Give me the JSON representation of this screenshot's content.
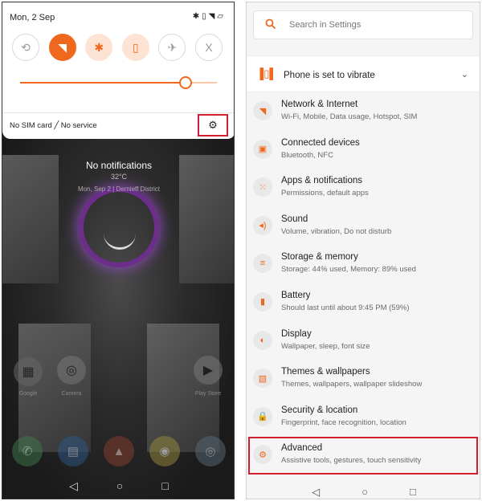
{
  "left_screen": {
    "status": {
      "date": "Mon, 2 Sep",
      "icons": [
        "bluetooth-icon",
        "vibrate-icon",
        "wifi-icon",
        "no-sim-icon"
      ]
    },
    "quick_settings": [
      {
        "icon": "auto-rotate-off-icon",
        "symbol": "⟲",
        "state": "off"
      },
      {
        "icon": "wifi-icon",
        "symbol": "◥",
        "state": "on"
      },
      {
        "icon": "bluetooth-icon",
        "symbol": "✱",
        "state": "on-light"
      },
      {
        "icon": "vibrate-icon",
        "symbol": "▯",
        "state": "on-light"
      },
      {
        "icon": "airplane-icon",
        "symbol": "✈",
        "state": "off"
      },
      {
        "icon": "x-mode-icon",
        "symbol": "X",
        "state": "off"
      }
    ],
    "brightness": 0.84,
    "sim_status": "No SIM card ╱ No service",
    "settings_gear": "⚙",
    "no_notifications": "No notifications",
    "weather": "32°C",
    "lock_date": "Mon, Sep 2  |  Dernieff District",
    "home_labels": [
      "Google",
      "Camera",
      "Play Store"
    ]
  },
  "right_screen": {
    "search_placeholder": "Search in Settings",
    "vibrate_banner": "Phone is set to vibrate",
    "items": [
      {
        "title": "Network & Internet",
        "sub": "Wi-Fi, Mobile, Data usage, Hotspot, SIM",
        "icon": "wifi-icon",
        "symbol": "◥"
      },
      {
        "title": "Connected devices",
        "sub": "Bluetooth, NFC",
        "icon": "devices-icon",
        "symbol": "▣"
      },
      {
        "title": "Apps & notifications",
        "sub": "Permissions, default apps",
        "icon": "apps-icon",
        "symbol": "⁙"
      },
      {
        "title": "Sound",
        "sub": "Volume, vibration, Do not disturb",
        "icon": "sound-icon",
        "symbol": "◂)"
      },
      {
        "title": "Storage & memory",
        "sub": "Storage: 44% used, Memory: 89% used",
        "icon": "storage-icon",
        "symbol": "≡"
      },
      {
        "title": "Battery",
        "sub": "Should last until about 9:45 PM (59%)",
        "icon": "battery-icon",
        "symbol": "▮"
      },
      {
        "title": "Display",
        "sub": "Wallpaper, sleep, font size",
        "icon": "display-icon",
        "symbol": "◐"
      },
      {
        "title": "Themes & wallpapers",
        "sub": "Themes, wallpapers, wallpaper slideshow",
        "icon": "themes-icon",
        "symbol": "▧"
      },
      {
        "title": "Security & location",
        "sub": "Fingerprint, face recognition, location",
        "icon": "lock-icon",
        "symbol": "🔒"
      },
      {
        "title": "Advanced",
        "sub": "Assistive tools, gestures, touch sensitivity",
        "icon": "gear-icon",
        "symbol": "⚙"
      }
    ]
  },
  "nav": {
    "back": "◁",
    "home": "○",
    "recents": "□"
  },
  "colors": {
    "accent": "#f0681e",
    "highlight_box": "#d02030"
  }
}
